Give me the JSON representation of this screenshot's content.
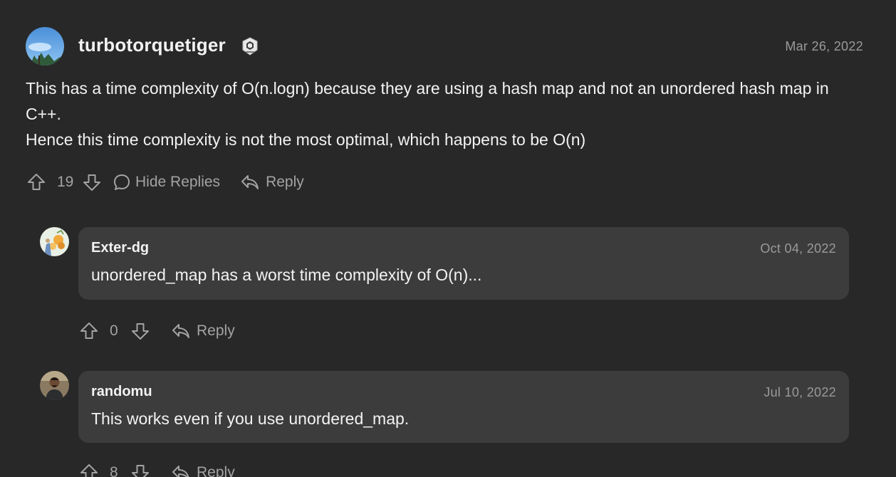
{
  "main_comment": {
    "username": "turbotorquetiger",
    "date": "Mar 26, 2022",
    "body_lines": [
      "This has a time complexity of O(n.logn) because they are using a hash map and not an unordered hash map in C++.",
      "Hence this time complexity is not the most optimal, which happens to be O(n)"
    ],
    "votes": "19",
    "hide_replies_label": "Hide Replies",
    "reply_label": "Reply"
  },
  "replies": [
    {
      "username": "Exter-dg",
      "date": "Oct 04, 2022",
      "text": "unordered_map has a worst time complexity of O(n)...",
      "votes": "0",
      "reply_label": "Reply"
    },
    {
      "username": "randomu",
      "date": "Jul 10, 2022",
      "text": "This works even if you use unordered_map.",
      "votes": "8",
      "reply_label": "Reply"
    }
  ],
  "icons": {
    "upvote": "arrow-up-icon",
    "downvote": "arrow-down-icon",
    "comment": "comment-bubble-icon",
    "reply": "reply-arrow-icon",
    "badge": "knight-badge-icon"
  },
  "colors": {
    "background": "#282828",
    "card": "#3c3c3c",
    "muted": "#a3a3a3",
    "text": "#f3f3f3"
  }
}
